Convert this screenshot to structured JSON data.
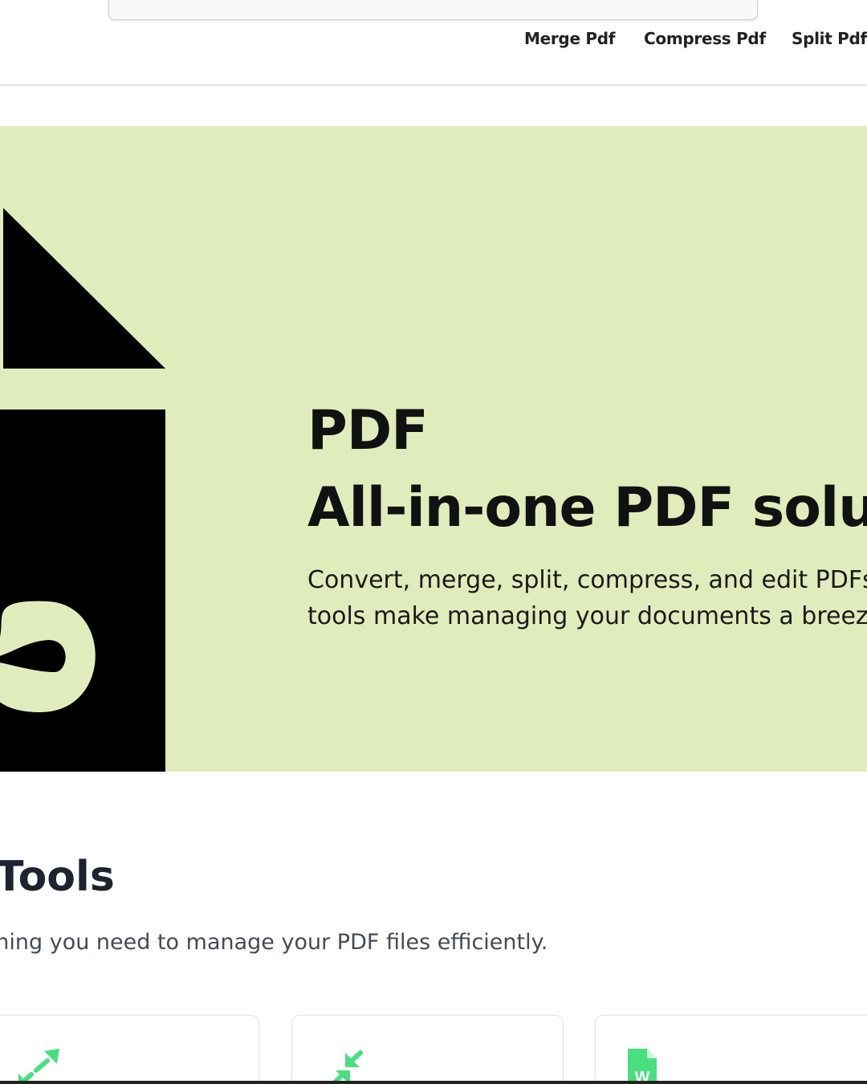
{
  "nav": {
    "items": [
      {
        "label": "Merge Pdf"
      },
      {
        "label": "Compress Pdf"
      },
      {
        "label": "Split Pdf"
      }
    ]
  },
  "hero": {
    "title_line1": "PDF",
    "title_line2": "All-in-one PDF solu",
    "description_line1": "Convert, merge, split, compress, and edit PDFs w",
    "description_line2": "tools make managing your documents a breeze.",
    "logo_icon": "pdf-logo-icon"
  },
  "tools": {
    "title": "Tools",
    "subtitle": "erything you need to manage your PDF files efficiently.",
    "cards": [
      {
        "icon": "expand-arrows-icon"
      },
      {
        "icon": "compress-arrows-icon"
      },
      {
        "icon": "word-file-icon",
        "icon_letter": "W"
      }
    ]
  },
  "colors": {
    "hero_background": "#e1ecbc",
    "accent_green": "#4ade80",
    "text_dark": "#111111"
  }
}
